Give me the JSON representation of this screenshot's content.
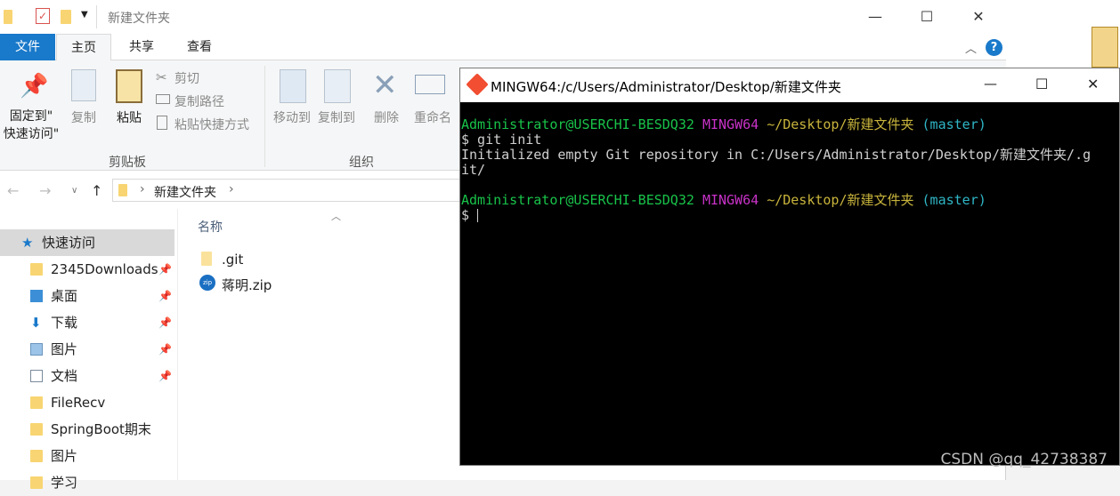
{
  "explorer": {
    "window_title": "新建文件夹",
    "controls": {
      "minimize": "—",
      "maximize": "☐",
      "close": "✕"
    },
    "tabs": [
      "文件",
      "主页",
      "共享",
      "查看"
    ],
    "ribbon": {
      "pin_label_1": "固定到\"",
      "pin_label_2": "快速访问\"",
      "copy": "复制",
      "paste": "粘贴",
      "cut": "剪切",
      "copy_path": "复制路径",
      "paste_shortcut": "粘贴快捷方式",
      "group_clipboard": "剪贴板",
      "move_to": "移动到",
      "copy_to": "复制到",
      "delete": "删除",
      "rename": "重命名",
      "group_organize": "组织"
    },
    "address": {
      "path": "新建文件夹",
      "sep": "›"
    },
    "sidebar": [
      {
        "label": "快速访问",
        "pinned": false
      },
      {
        "label": "2345Downloads",
        "pinned": true
      },
      {
        "label": "桌面",
        "pinned": true
      },
      {
        "label": "下载",
        "pinned": true
      },
      {
        "label": "图片",
        "pinned": true
      },
      {
        "label": "文档",
        "pinned": true
      },
      {
        "label": "FileRecv",
        "pinned": false
      },
      {
        "label": "SpringBoot期末",
        "pinned": false
      },
      {
        "label": "图片",
        "pinned": false
      },
      {
        "label": "学习",
        "pinned": false
      }
    ],
    "column_header": "名称",
    "files": [
      ".git",
      "蒋明.zip"
    ]
  },
  "terminal": {
    "title": "MINGW64:/c/Users/Administrator/Desktop/新建文件夹",
    "prompt_user": "Administrator@USERCHI-BESDQ32",
    "prompt_env": "MINGW64",
    "prompt_path": "~/Desktop/新建文件夹",
    "prompt_branch": "(master)",
    "command": "$ git init",
    "output_1": "Initialized empty Git repository in C:/Users/Administrator/Desktop/新建文件夹/.g",
    "output_2": "it/",
    "prompt_symbol": "$",
    "colors": {
      "user": "#19c34a",
      "env": "#c832c8",
      "path": "#c8b43c",
      "branch": "#2fb6c6"
    }
  },
  "watermark": "CSDN @qq_42738387"
}
